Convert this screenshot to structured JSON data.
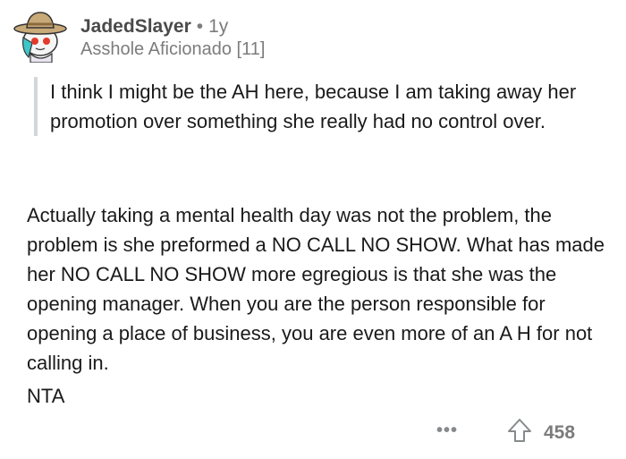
{
  "comment": {
    "author": "JadedSlayer",
    "separator": "•",
    "age": "1y",
    "flair": "Asshole Aficionado [11]",
    "quote": "I think I might be the AH here, because I am taking away her promotion over something she really had no control over.",
    "paragraphs": [
      "Actually taking a mental health day was not the problem, the problem is she preformed a NO CALL NO SHOW. What has made her NO CALL NO SHOW more egregious is that she was the opening manager. When you are the person responsible for opening a place of business, you are even more of an A H for not calling in.",
      "NTA"
    ],
    "more_label": "•••",
    "upvotes": "458"
  },
  "icons": {
    "avatar": "snoo-cowboy-avatar",
    "more": "more-options-icon",
    "upvote": "upvote-arrow-icon"
  }
}
